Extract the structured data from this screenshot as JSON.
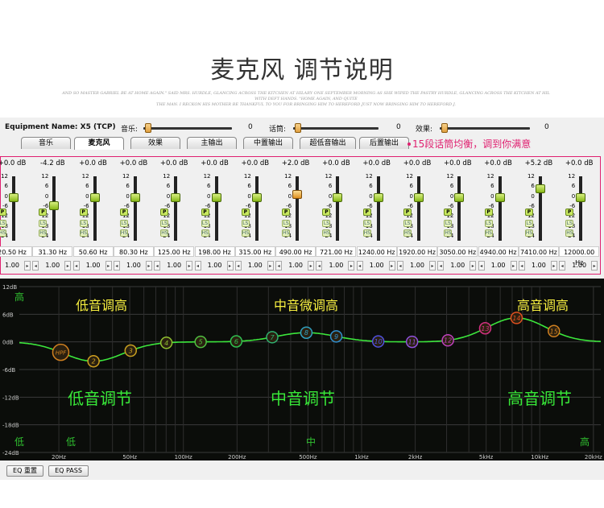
{
  "header": {
    "title": "麦克风 调节说明",
    "subtext": [
      "AND SO MASTER GABRIEL BE AT HOME AGAIN.\"  SAID MRS. HURDLE, GLANCING ACROSS THE KITCHEN AT HILARY ONE SEPTEMBER MORNING AS SHE WIPED THE PASTRY HURDLE, GLANCING ACROSS THE KITCHEN AT HIL",
      "WITH DEFT HANDS.  \"HOME AGAIN, AND QUITE",
      "THE MAN. I RECKON HIS MOTHER BE THANKFUL TO YOU FOR BRINGING HIM TO HEREFORD JUST NOW BRINGING HIM TO HEREFORD J."
    ]
  },
  "topbar": {
    "equipment": "Equipment Name: X5 (TCP)",
    "music_label": "音乐:",
    "music_value": "0",
    "talk_label": "话筒:",
    "talk_value": "0",
    "effect_label": "效果:",
    "effect_value": "0"
  },
  "tabs": [
    "音乐",
    "麦克风",
    "效果",
    "主输出",
    "中置输出",
    "超低音输出",
    "后置输出"
  ],
  "annotation": "15段话筒均衡，调到你满意",
  "bands": [
    {
      "gain": "+0.0 dB",
      "freq": "20.50 Hz",
      "q": "1.00",
      "level": 0
    },
    {
      "gain": "-4.2 dB",
      "freq": "31.30 Hz",
      "q": "1.00",
      "level": -4.2
    },
    {
      "gain": "+0.0 dB",
      "freq": "50.60 Hz",
      "q": "1.00",
      "level": 0
    },
    {
      "gain": "+0.0 dB",
      "freq": "80.30 Hz",
      "q": "1.00",
      "level": 0
    },
    {
      "gain": "+0.0 dB",
      "freq": "125.00 Hz",
      "q": "1.00",
      "level": 0
    },
    {
      "gain": "+0.0 dB",
      "freq": "198.00 Hz",
      "q": "1.00",
      "level": 0
    },
    {
      "gain": "+0.0 dB",
      "freq": "315.00 Hz",
      "q": "1.00",
      "level": 0
    },
    {
      "gain": "+2.0 dB",
      "freq": "490.00 Hz",
      "q": "1.00",
      "level": 2
    },
    {
      "gain": "+0.0 dB",
      "freq": "721.00 Hz",
      "q": "1.00",
      "level": 0
    },
    {
      "gain": "+0.0 dB",
      "freq": "1240.00 Hz",
      "q": "1.00",
      "level": 0
    },
    {
      "gain": "+0.0 dB",
      "freq": "1920.00 Hz",
      "q": "1.00",
      "level": 0
    },
    {
      "gain": "+0.0 dB",
      "freq": "3050.00 Hz",
      "q": "1.00",
      "level": 0
    },
    {
      "gain": "+0.0 dB",
      "freq": "4940.00 Hz",
      "q": "1.00",
      "level": 0
    },
    {
      "gain": "+5.2 dB",
      "freq": "7410.00 Hz",
      "q": "1.00",
      "level": 5.2
    },
    {
      "gain": "+0.0 dB",
      "freq": "12000.00 Hz",
      "q": "1.00",
      "level": 0
    }
  ],
  "scale_ticks": [
    "12",
    "6",
    "0",
    "-6",
    "-12",
    "-18",
    "-24"
  ],
  "band_buttons": {
    "p": "P",
    "ls": "LS",
    "hs": "HS"
  },
  "graph": {
    "y_ticks": [
      "12dB",
      "6dB",
      "0dB",
      "-6dB",
      "-12dB",
      "-18dB",
      "-24dB"
    ],
    "x_ticks": [
      "20Hz",
      "50Hz",
      "100Hz",
      "200Hz",
      "500Hz",
      "1kHz",
      "2kHz",
      "5kHz",
      "10kHz",
      "20kHz"
    ],
    "labels": {
      "low_boost": "低音调高",
      "mid_boost": "中音微调高",
      "high_boost": "高音调高",
      "low_adjust": "低音调节",
      "mid_adjust": "中音调节",
      "high_adjust": "高音调节",
      "left_high": "高",
      "left_low": "低",
      "bottom_low": "低",
      "bottom_mid": "中",
      "right_high": "高"
    },
    "nodes": [
      "HPF",
      "2",
      "3",
      "4",
      "5",
      "6",
      "7",
      "8",
      "9",
      "10",
      "11",
      "12",
      "13",
      "14",
      "15"
    ],
    "curve_color": "#3ce63c"
  },
  "buttons": {
    "eq_reset": "EQ 重置",
    "eq_pass": "EQ PASS"
  }
}
